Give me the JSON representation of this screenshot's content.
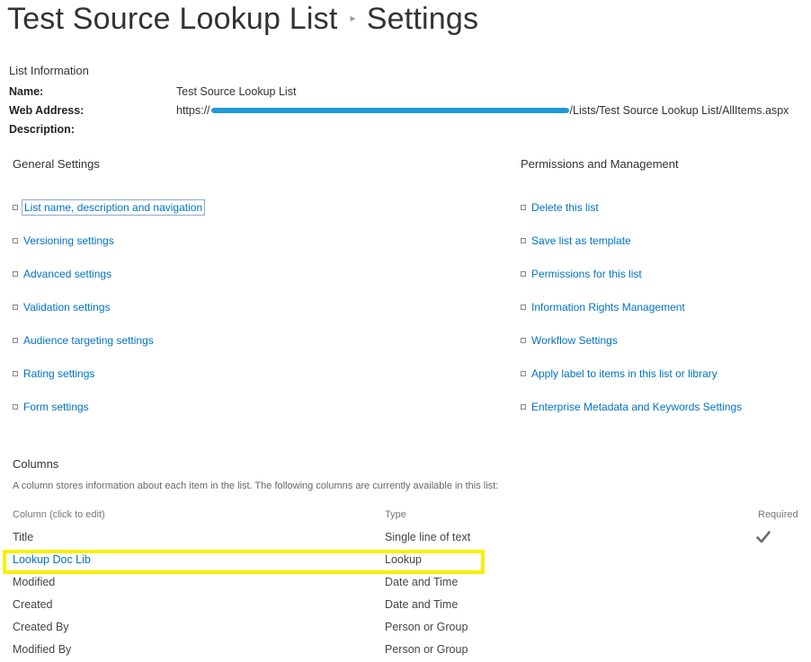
{
  "header": {
    "list_title": "Test Source Lookup List",
    "separator": "▸",
    "page_title": "Settings"
  },
  "list_info": {
    "heading": "List Information",
    "name_label": "Name:",
    "name_value": "Test Source Lookup List",
    "web_address_label": "Web Address:",
    "web_address_prefix": "https://",
    "web_address_suffix": "/Lists/Test Source Lookup List/AllItems.aspx",
    "description_label": "Description:"
  },
  "general_settings": {
    "heading": "General Settings",
    "items": [
      {
        "label": "List name, description and navigation"
      },
      {
        "label": "Versioning settings"
      },
      {
        "label": "Advanced settings"
      },
      {
        "label": "Validation settings"
      },
      {
        "label": "Audience targeting settings"
      },
      {
        "label": "Rating settings"
      },
      {
        "label": "Form settings"
      }
    ]
  },
  "permissions": {
    "heading": "Permissions and Management",
    "items": [
      {
        "label": "Delete this list"
      },
      {
        "label": "Save list as template"
      },
      {
        "label": "Permissions for this list"
      },
      {
        "label": "Information Rights Management"
      },
      {
        "label": "Workflow Settings"
      },
      {
        "label": "Apply label to items in this list or library"
      },
      {
        "label": "Enterprise Metadata and Keywords Settings"
      }
    ]
  },
  "columns": {
    "heading": "Columns",
    "description": "A column stores information about each item in the list. The following columns are currently available in this list:",
    "headers": {
      "column": "Column (click to edit)",
      "type": "Type",
      "required": "Required"
    },
    "rows": [
      {
        "name": "Title",
        "type": "Single line of text",
        "required": true
      },
      {
        "name": "Lookup Doc Lib",
        "type": "Lookup",
        "required": false
      },
      {
        "name": "Modified",
        "type": "Date and Time",
        "required": false
      },
      {
        "name": "Created",
        "type": "Date and Time",
        "required": false
      },
      {
        "name": "Created By",
        "type": "Person or Group",
        "required": false
      },
      {
        "name": "Modified By",
        "type": "Person or Group",
        "required": false
      }
    ]
  },
  "colors": {
    "link": "#0072c6",
    "redaction": "#1f9ad6",
    "highlight": "#f8f000"
  },
  "icons": {
    "required_mark": "checkmark-icon",
    "bullet": "square-bullet-icon"
  }
}
